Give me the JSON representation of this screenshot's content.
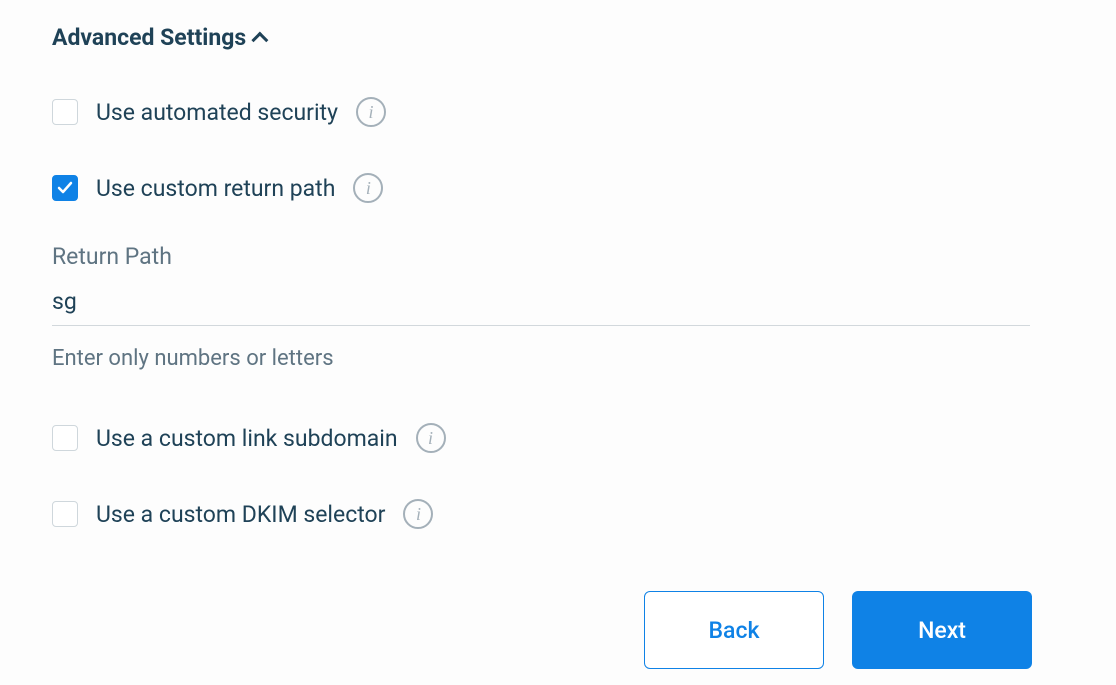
{
  "section": {
    "title": "Advanced Settings"
  },
  "options": {
    "automated_security": {
      "label": "Use automated security",
      "checked": false
    },
    "custom_return_path": {
      "label": "Use custom return path",
      "checked": true
    },
    "custom_link_subdomain": {
      "label": "Use a custom link subdomain",
      "checked": false
    },
    "custom_dkim_selector": {
      "label": "Use a custom DKIM selector",
      "checked": false
    }
  },
  "return_path": {
    "label": "Return Path",
    "value": "sg",
    "helper": "Enter only numbers or letters"
  },
  "buttons": {
    "back": "Back",
    "next": "Next"
  }
}
